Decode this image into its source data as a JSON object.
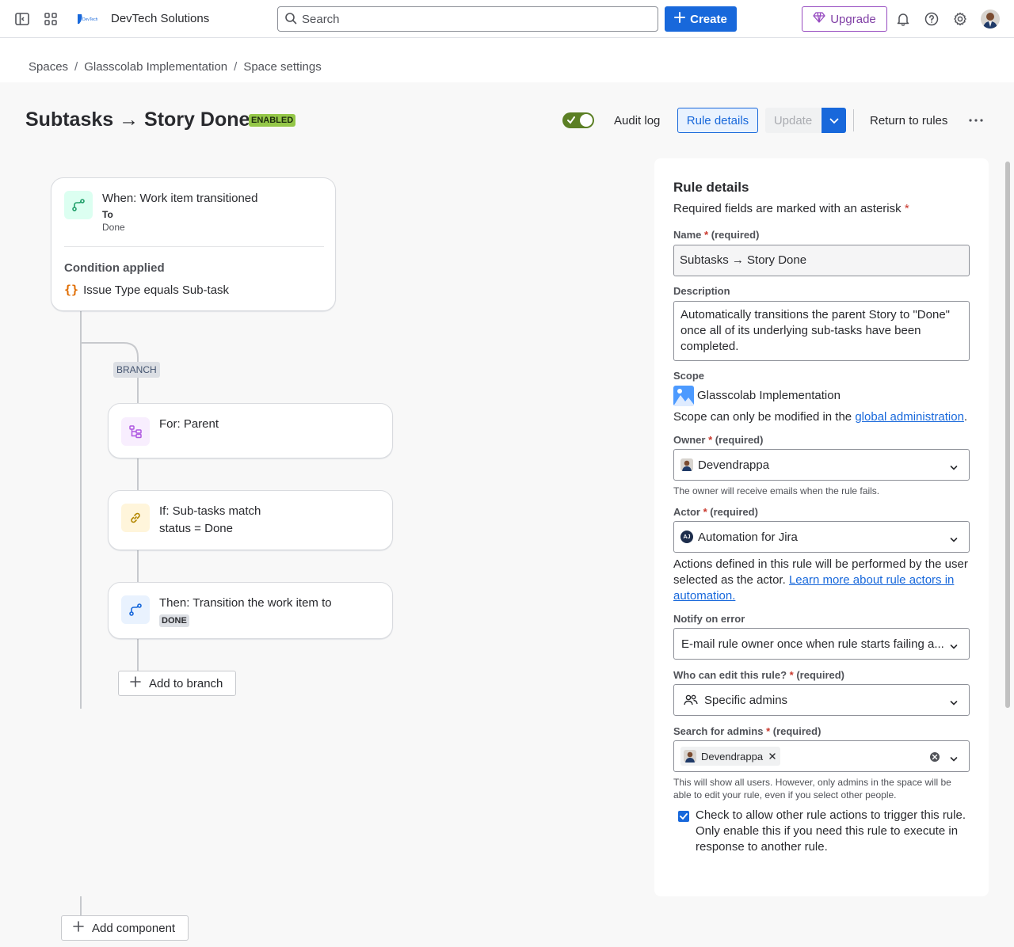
{
  "nav": {
    "brand_name": "DevTech Solutions",
    "logo_text": "DevTech",
    "search_placeholder": "Search",
    "create_label": "Create",
    "upgrade_label": "Upgrade"
  },
  "breadcrumb": [
    "Spaces",
    "Glasscolab Implementation",
    "Space settings"
  ],
  "header": {
    "title": "Subtasks → Story Done",
    "status_badge": "ENABLED",
    "audit_log": "Audit log",
    "rule_details": "Rule details",
    "update": "Update",
    "return_to_rules": "Return to rules"
  },
  "flow": {
    "trigger": {
      "title": "When: Work item transitioned",
      "to_label": "To",
      "to_value": "Done",
      "condition_heading": "Condition applied",
      "condition_text": "Issue Type equals Sub-task"
    },
    "branch_label": "BRANCH",
    "branch_for": "For: Parent",
    "if_title": "If: Sub-tasks match",
    "if_condition": "status = Done",
    "then_title": "Then: Transition the work item to",
    "then_status": "DONE",
    "add_to_branch": "Add to branch",
    "add_component": "Add component"
  },
  "panel": {
    "title": "Rule details",
    "required_note": "Required fields are marked with an asterisk",
    "asterisk": "*",
    "required_text": "(required)",
    "name_label": "Name",
    "name_value": "Subtasks → Story Done",
    "description_label": "Description",
    "description_value": "Automatically transitions the parent Story to \"Done\" once all of its underlying sub-tasks have been completed.",
    "scope_label": "Scope",
    "scope_value": "Glasscolab Implementation",
    "scope_note_prefix": "Scope can only be modified in the",
    "scope_note_link": "global administration",
    "scope_note_suffix": ".",
    "owner_label": "Owner",
    "owner_value": "Devendrappa",
    "owner_help": "The owner will receive emails when the rule fails.",
    "actor_label": "Actor",
    "actor_avatar": "AJ",
    "actor_value": "Automation for Jira",
    "actor_note_prefix": "Actions defined in this rule will be performed by the user selected as the actor.",
    "actor_note_link": "Learn more about rule actors in automation.",
    "notify_label": "Notify on error",
    "notify_value": "E-mail rule owner once when rule starts failing a...",
    "who_edit_label": "Who can edit this rule?",
    "who_edit_value": "Specific admins",
    "search_admins_label": "Search for admins",
    "admin_chip": "Devendrappa",
    "admins_help": "This will show all users. However, only admins in the space will be able to edit your rule, even if you select other people.",
    "checkbox_label": "Check to allow other rule actions to trigger this rule. Only enable this if you need this rule to execute in response to another rule.",
    "checkbox_checked": true
  },
  "colors": {
    "primary": "#1868db",
    "enabled": "#94c748",
    "toggle_on": "#5b7f24",
    "upgrade": "#964ac0"
  },
  "icons": [
    "sidebar-toggle-icon",
    "app-switcher-icon",
    "search-icon",
    "plus-icon",
    "gem-icon",
    "bell-icon",
    "help-icon",
    "gear-icon",
    "chevron-down-icon",
    "more-icon",
    "transition-icon",
    "branch-icon",
    "link-icon",
    "curly-braces-icon"
  ]
}
